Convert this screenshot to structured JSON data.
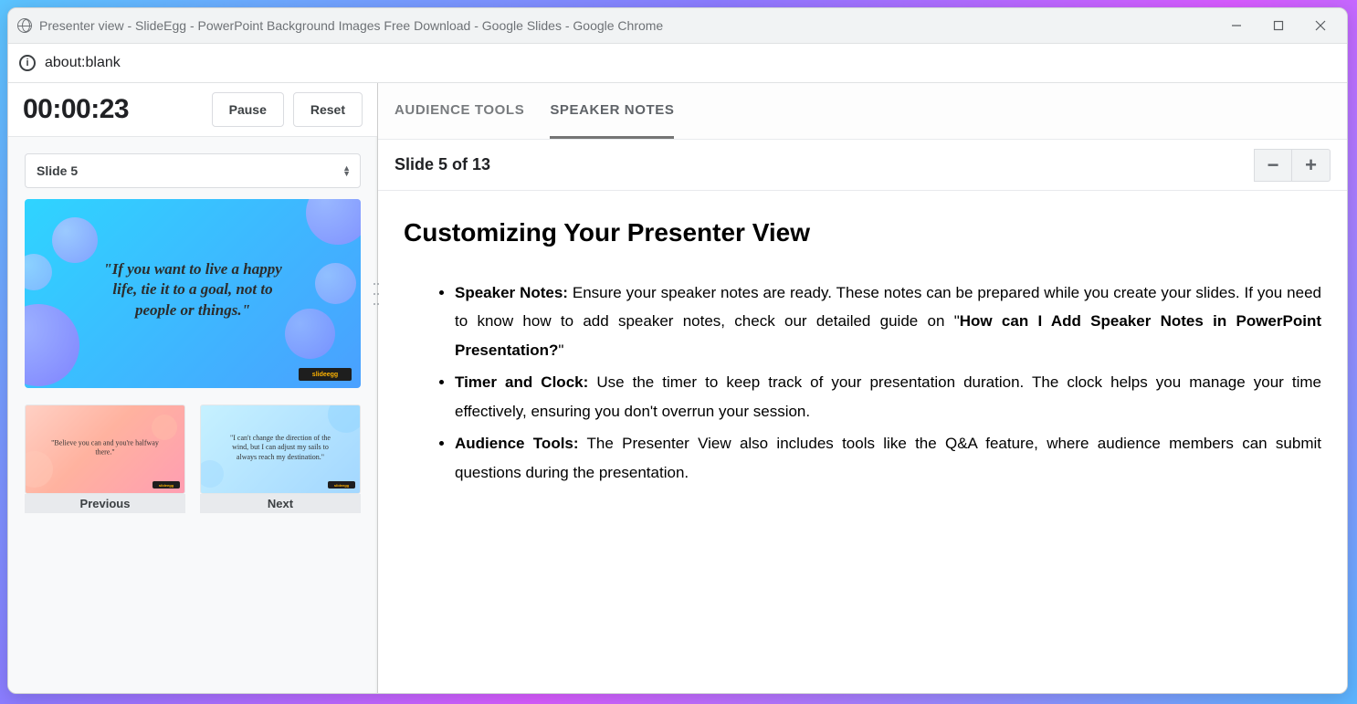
{
  "window_title": "Presenter view - SlideEgg - PowerPoint Background Images Free Download - Google Slides - Google Chrome",
  "url": "about:blank",
  "timer": "00:00:23",
  "pause_label": "Pause",
  "reset_label": "Reset",
  "slide_selector": "Slide 5",
  "current_slide_quote": "\"If you want to live a happy life, tie it to a goal, not to people or things.\"",
  "slide_brand": "slideegg",
  "prev": {
    "label": "Previous",
    "quote": "\"Believe you can and you're halfway there.\""
  },
  "next": {
    "label": "Next",
    "quote": "\"I can't change the direction of the wind, but I can adjust my sails to always reach my destination.\""
  },
  "tabs": {
    "audience": "AUDIENCE TOOLS",
    "speaker": "SPEAKER NOTES"
  },
  "notes": {
    "slide_of": "Slide 5 of 13",
    "heading": "Customizing Your Presenter View",
    "items": [
      {
        "bold_lead": "Speaker Notes:",
        "text": " Ensure your speaker notes are ready. These notes can be prepared while you create your slides. If you need to know how to add speaker notes, check our detailed guide on \"",
        "bold_inline": "How can I Add Speaker Notes in PowerPoint Presentation?",
        "tail": "\""
      },
      {
        "bold_lead": "Timer and Clock:",
        "text": " Use the timer to keep track of your presentation duration. The clock helps you manage your time effectively, ensuring you don't overrun your session."
      },
      {
        "bold_lead": "Audience Tools:",
        "text": " The Presenter View also includes tools like the Q&A feature, where audience members can submit questions during the presentation."
      }
    ]
  }
}
